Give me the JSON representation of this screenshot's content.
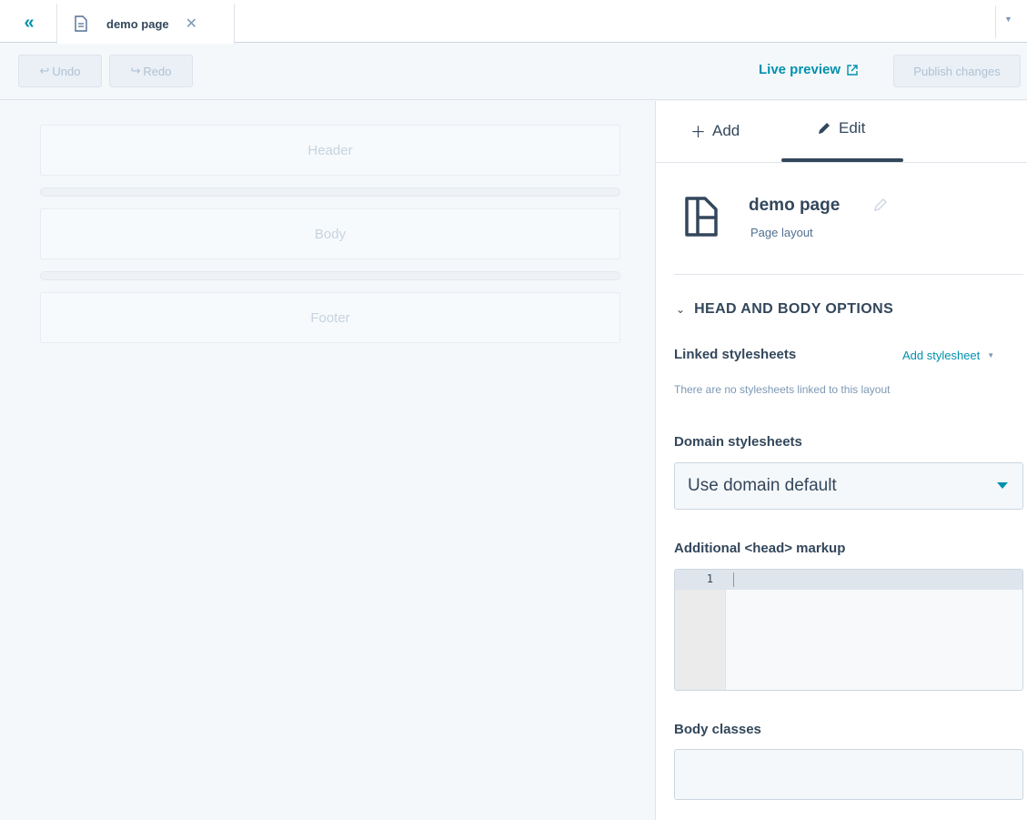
{
  "tabbar": {
    "collapse_icon": "double-chevron-left-icon",
    "tab_label": "demo page",
    "close_glyph": "✕"
  },
  "toolbar": {
    "undo_label": "Undo",
    "redo_label": "Redo",
    "live_preview_label": "Live preview",
    "publish_label": "Publish changes"
  },
  "canvas": {
    "sections": [
      "Header",
      "Body",
      "Footer"
    ]
  },
  "panel": {
    "tabs": {
      "add_label": "Add",
      "edit_label": "Edit",
      "active": "Edit"
    },
    "page": {
      "title": "demo page",
      "subtitle": "Page layout"
    },
    "section_title": "HEAD AND BODY OPTIONS",
    "linked_stylesheets": {
      "label": "Linked stylesheets",
      "action_label": "Add stylesheet",
      "empty_text": "There are no stylesheets linked to this layout"
    },
    "domain_stylesheets": {
      "label": "Domain stylesheets",
      "selected": "Use domain default"
    },
    "head_markup": {
      "label": "Additional <head> markup",
      "line_number": "1",
      "value": ""
    },
    "body_classes": {
      "label": "Body classes",
      "value": ""
    }
  },
  "colors": {
    "accent": "#0091ae",
    "text": "#33475b",
    "muted": "#7c98b6",
    "border": "#cbd6e2",
    "disabled_text": "#b0c1d4"
  }
}
